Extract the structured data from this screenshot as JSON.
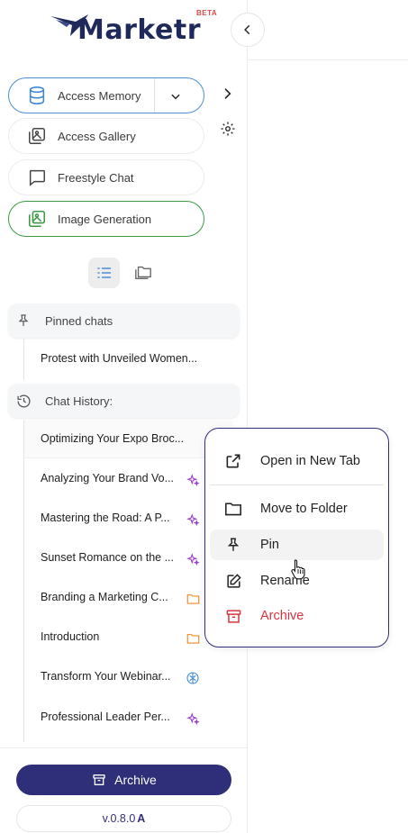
{
  "brand": {
    "name": "Marketr",
    "badge": "BETA",
    "color": "#1f2a5a"
  },
  "modes": [
    {
      "label": "Access Memory",
      "icon": "database-icon",
      "accent": "#4a8fd8"
    },
    {
      "label": "Access Gallery",
      "icon": "gallery-icon"
    },
    {
      "label": "Freestyle Chat",
      "icon": "chat-bubble-icon"
    },
    {
      "label": "Image Generation",
      "icon": "image-icon",
      "accent": "#3c9a45"
    }
  ],
  "pinned": {
    "title": "Pinned chats",
    "items": [
      {
        "label": "Protest with Unveiled Women..."
      }
    ]
  },
  "history": {
    "title": "Chat History:",
    "items": [
      {
        "label": "Optimizing Your Expo Broc...",
        "tag": "none"
      },
      {
        "label": "Analyzing Your Brand Vo...",
        "tag": "sparkle-icon"
      },
      {
        "label": "Mastering the Road: A P...",
        "tag": "sparkle-icon"
      },
      {
        "label": "Sunset Romance on the ...",
        "tag": "sparkle-icon"
      },
      {
        "label": "Branding a Marketing C...",
        "tag": "folder-icon"
      },
      {
        "label": "Introduction",
        "tag": "folder-icon"
      },
      {
        "label": "Transform Your Webinar...",
        "tag": "brain-icon"
      },
      {
        "label": "Professional Leader Per...",
        "tag": "sparkle-icon"
      }
    ]
  },
  "context_menu": {
    "items": [
      {
        "label": "Open in New Tab",
        "icon": "external-link-icon"
      },
      {
        "label": "Move to Folder",
        "icon": "folder-icon"
      },
      {
        "label": "Pin",
        "icon": "pin-icon"
      },
      {
        "label": "Rename",
        "icon": "edit-icon"
      },
      {
        "label": "Archive",
        "icon": "archive-icon",
        "color": "#d8343f"
      }
    ]
  },
  "footer": {
    "archive_label": "Archive",
    "version": "v.0.8.0",
    "version_suffix": "A",
    "button_color": "#2e2f78"
  }
}
